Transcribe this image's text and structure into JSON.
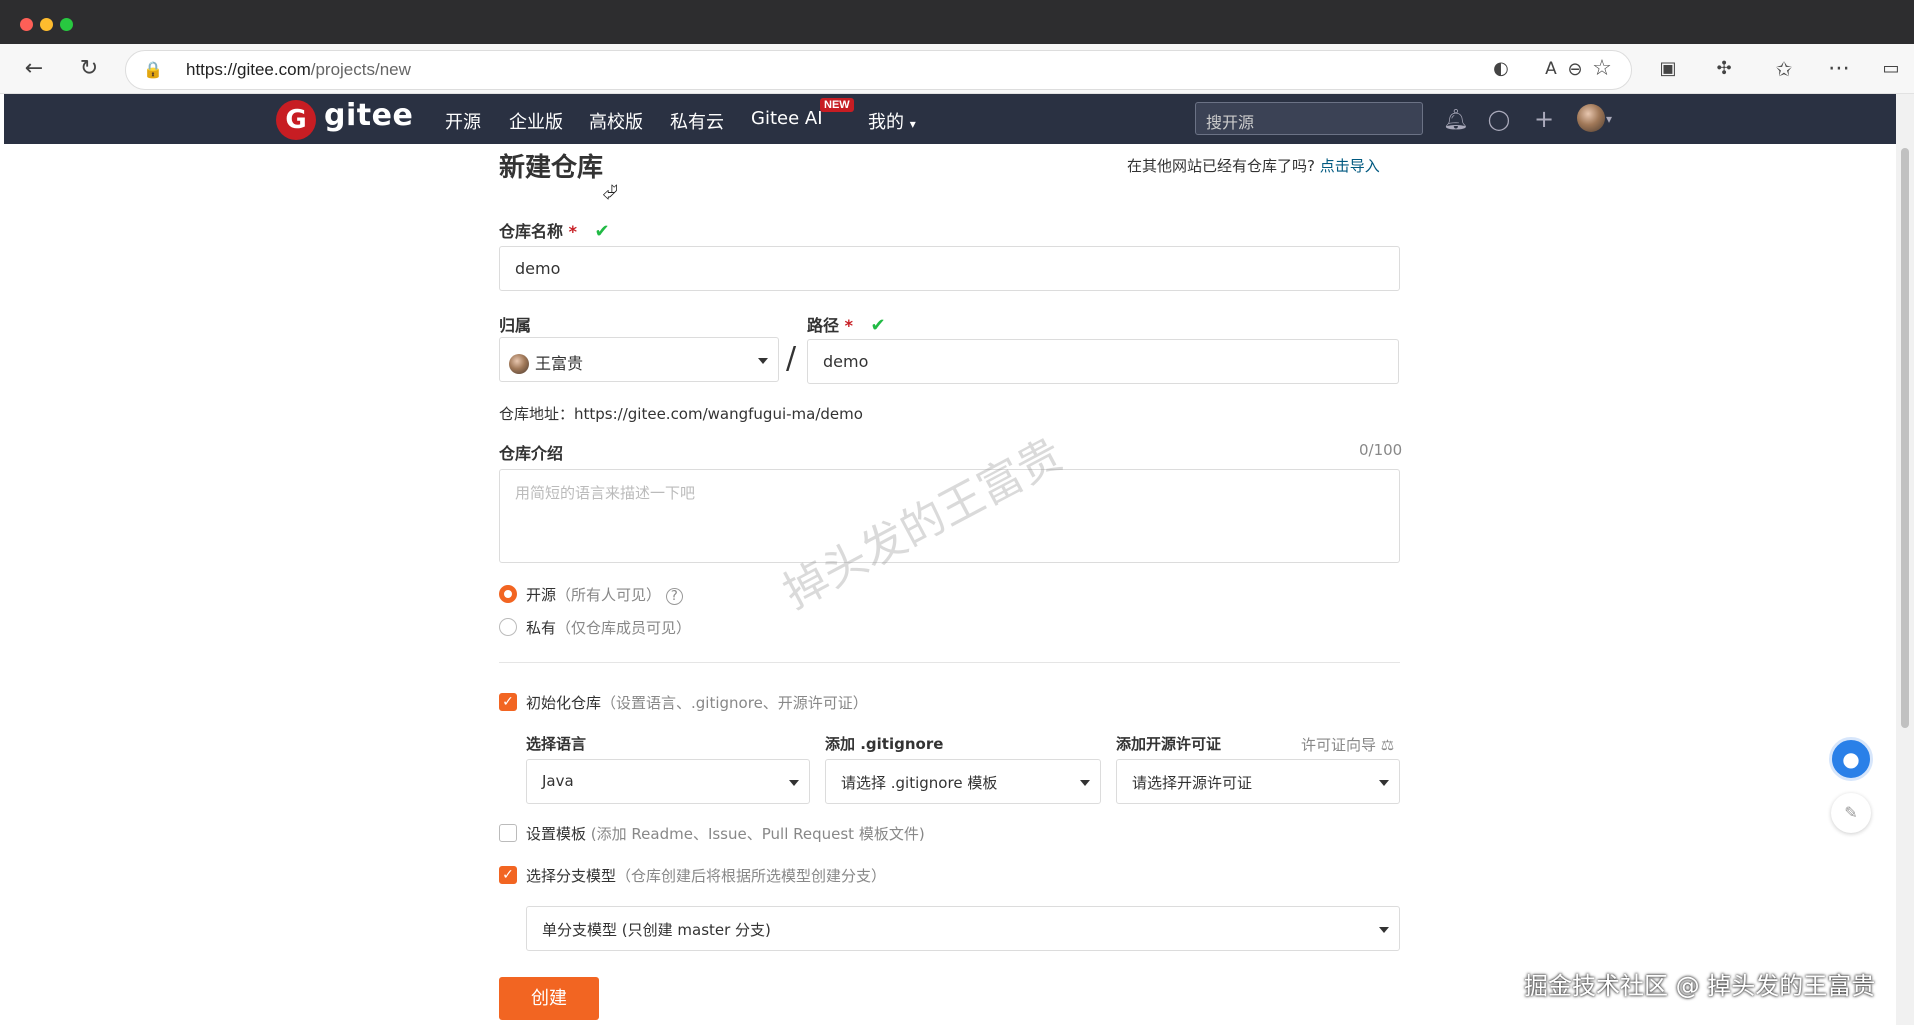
{
  "browser": {
    "url_host": "https://gitee.com",
    "url_path": "/projects/new",
    "icons": [
      "back-icon",
      "reload-icon",
      "lock-icon",
      "zoom-out-icon",
      "edge-icon",
      "read-aloud-icon",
      "favorite-icon",
      "extension-icon",
      "puzzle-icon",
      "favorites-icon",
      "more-icon",
      "sidebar-icon"
    ]
  },
  "navbar": {
    "logo_letter": "G",
    "logo_text": "gitee",
    "items": [
      "开源",
      "企业版",
      "高校版",
      "私有云",
      "Gitee AI",
      "我的"
    ],
    "new_badge": "NEW",
    "search_placeholder": "搜开源"
  },
  "form": {
    "title": "新建仓库",
    "import_question": "在其他网站已经有仓库了吗?",
    "import_link": "点击导入",
    "repo_name_label": "仓库名称",
    "required_mark": "*",
    "repo_name_value": "demo",
    "owner_label": "归属",
    "owner_value": "王富贵",
    "path_label": "路径",
    "path_value": "demo",
    "slash": "/",
    "repo_address": "仓库地址：https://gitee.com/wangfugui-ma/demo",
    "intro_label": "仓库介绍",
    "intro_count": "0/100",
    "intro_placeholder": "用简短的语言来描述一下吧",
    "visibility": {
      "public_label": "开源",
      "public_hint": "（所有人可见）",
      "private_label": "私有",
      "private_hint": "（仅仓库成员可见）",
      "selected": "public"
    },
    "init_repo": {
      "label": "初始化仓库",
      "hint": "（设置语言、.gitignore、开源许可证）",
      "checked": true
    },
    "language_label": "选择语言",
    "language_value": "Java",
    "gitignore_label": "添加 .gitignore",
    "gitignore_value": "请选择 .gitignore 模板",
    "license_label": "添加开源许可证",
    "license_guide": "许可证向导",
    "license_value": "请选择开源许可证",
    "template": {
      "label": "设置模板",
      "hint": "(添加 Readme、Issue、Pull Request 模板文件)",
      "checked": false
    },
    "branch_model": {
      "label": "选择分支模型",
      "hint": "（仓库创建后将根据所选模型创建分支）",
      "checked": true,
      "value": "单分支模型 (只创建 master 分支)"
    },
    "create_button": "创建"
  },
  "overlay": {
    "watermark": "掉头发的王富贵",
    "juejin_credit": "掘金技术社区 @ 掉头发的王富贵"
  }
}
